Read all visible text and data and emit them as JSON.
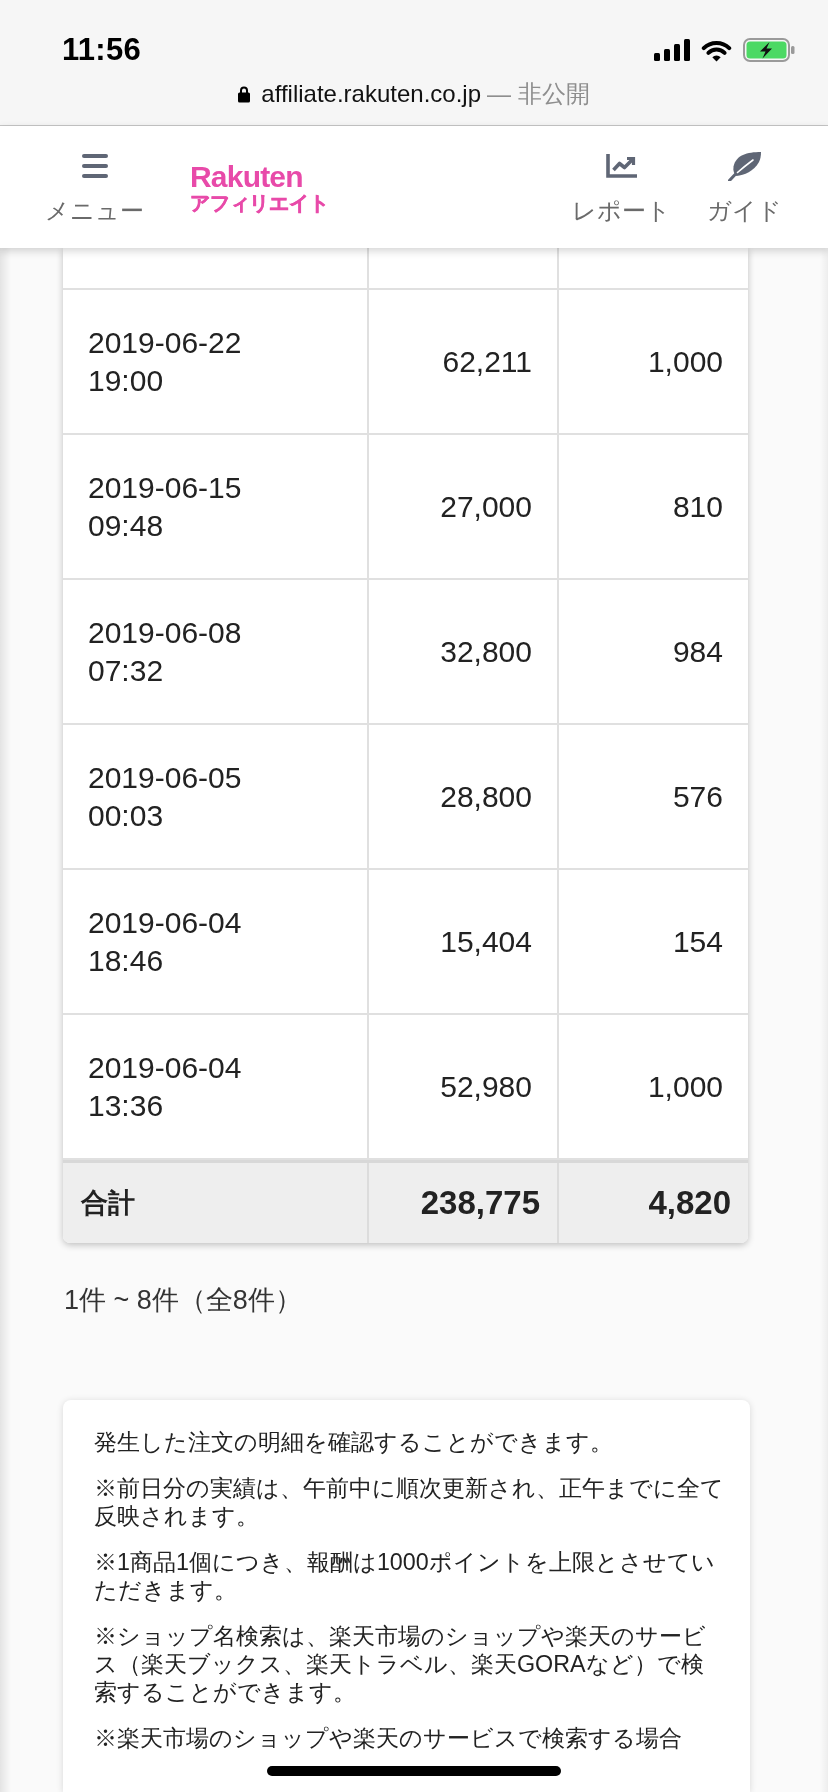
{
  "browser": {
    "time": "11:56",
    "url": "affiliate.rakuten.co.jp",
    "privacy": "— 非公開"
  },
  "header": {
    "nav_left": [
      {
        "kind": "menu",
        "label": "メニュー"
      }
    ],
    "logo": {
      "line_1": "Rakuten",
      "line_2": "アフィリエイト"
    },
    "nav_right": [
      {
        "kind": "report",
        "label": "レポート"
      },
      {
        "kind": "guide",
        "label": "ガイド"
      }
    ]
  },
  "table": {
    "rows": [
      {
        "date_time": "2019-06-22 19:00",
        "column_2": "62,211",
        "column_3": "1,000"
      },
      {
        "date_time": "2019-06-15 09:48",
        "column_2": "27,000",
        "column_3": "810"
      },
      {
        "date_time": "2019-06-08 07:32",
        "column_2": "32,800",
        "column_3": "984"
      },
      {
        "date_time": "2019-06-05 00:03",
        "column_2": "28,800",
        "column_3": "576"
      },
      {
        "date_time": "2019-06-04 18:46",
        "column_2": "15,404",
        "column_3": "154"
      },
      {
        "date_time": "2019-06-04 13:36",
        "column_2": "52,980",
        "column_3": "1,000"
      }
    ],
    "total": {
      "label": "合計",
      "column_2": "238,775",
      "column_3": "4,820"
    }
  },
  "pagination": {
    "summary": "1件 ~ 8件（全8件）"
  },
  "notes": [
    "発生した注文の明細を確認することができます。",
    "※前日分の実績は、午前中に順次更新され、正午までに全て反映されます。",
    "※1商品1個につき、報酬は1000ポイントを上限とさせていただきます。",
    "※ショップ名検索は、楽天市場のショップや楽天のサービス（楽天ブックス、楽天トラベル、楽天GORAなど）で検索することができます。",
    "※楽天市場のショップや楽天のサービスで検索する場合"
  ]
}
